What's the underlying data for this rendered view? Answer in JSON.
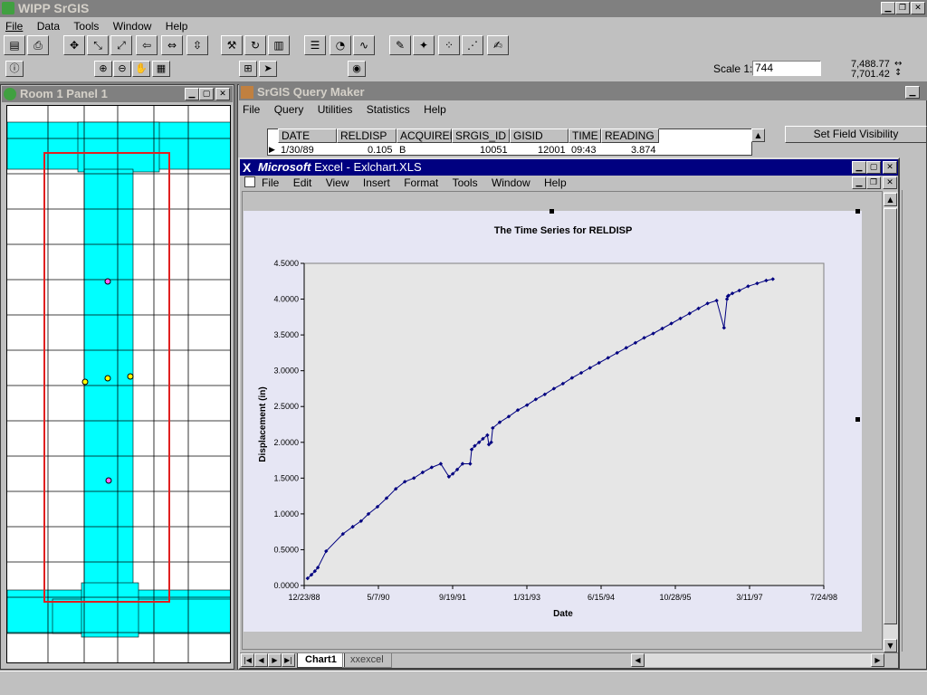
{
  "app": {
    "title": "WIPP SrGIS",
    "menu": [
      "File",
      "Data",
      "Tools",
      "Window",
      "Help"
    ]
  },
  "toolbar": {
    "scale_label": "Scale  1:",
    "scale_value": "744",
    "coord_x": "7,488.77",
    "coord_y": "7,701.42"
  },
  "map_panel": {
    "title": "Room 1 Panel 1"
  },
  "query_maker": {
    "title": "SrGIS Query Maker",
    "menu": [
      "File",
      "Query",
      "Utilities",
      "Statistics",
      "Help"
    ],
    "columns": [
      "DATE",
      "RELDISP",
      "ACQUIRED",
      "SRGIS_ID",
      "GISID",
      "TIME",
      "READING"
    ],
    "row": [
      "1/30/89",
      "0.105",
      "B",
      "10051",
      "12001",
      "09:43",
      "3.874"
    ],
    "set_field_button": "Set Field Visibility"
  },
  "excel": {
    "title_brand": "Microsoft",
    "title_rest": "Excel - Exlchart.XLS",
    "menu": [
      "File",
      "Edit",
      "View",
      "Insert",
      "Format",
      "Tools",
      "Window",
      "Help"
    ],
    "tabs": [
      "Chart1",
      "xxexcel"
    ]
  },
  "chart_data": {
    "type": "line",
    "title": "The Time Series for RELDISP",
    "xlabel": "Date",
    "ylabel": "Displacement (in)",
    "x_tick_labels": [
      "12/23/88",
      "5/7/90",
      "9/19/91",
      "1/31/93",
      "6/15/94",
      "10/28/95",
      "3/11/97",
      "7/24/98"
    ],
    "y_tick_labels": [
      "0.0000",
      "0.5000",
      "1.0000",
      "1.5000",
      "2.0000",
      "2.5000",
      "3.0000",
      "3.5000",
      "4.0000",
      "4.5000"
    ],
    "ylim": [
      0,
      4.5
    ],
    "xlim": [
      "1988-12-23",
      "1998-07-24"
    ],
    "grid": false,
    "legend": "none",
    "marker": "diamond",
    "color": "#000080",
    "series": [
      {
        "x": [
          "1989-01-15",
          "1989-02-10",
          "1989-03-05",
          "1989-03-25",
          "1989-05-20",
          "1989-09-10",
          "1989-11-15",
          "1990-01-10",
          "1990-03-01",
          "1990-05-01",
          "1990-07-01",
          "1990-09-01",
          "1990-11-01",
          "1991-01-01",
          "1991-03-01",
          "1991-05-01",
          "1991-07-01",
          "1991-08-25",
          "1991-09-20",
          "1991-10-20",
          "1991-11-25",
          "1992-01-15",
          "1992-01-25",
          "1992-02-15",
          "1992-03-15",
          "1992-04-10",
          "1992-05-10",
          "1992-05-20",
          "1992-06-05",
          "1992-06-15",
          "1992-08-01",
          "1992-10-01",
          "1992-12-01",
          "1993-02-01",
          "1993-04-01",
          "1993-06-01",
          "1993-08-01",
          "1993-10-01",
          "1993-12-01",
          "1994-02-01",
          "1994-04-01",
          "1994-06-01",
          "1994-08-01",
          "1994-10-01",
          "1994-12-01",
          "1995-02-01",
          "1995-04-01",
          "1995-06-01",
          "1995-08-01",
          "1995-10-01",
          "1995-12-01",
          "1996-02-01",
          "1996-04-01",
          "1996-06-01",
          "1996-08-01",
          "1996-09-20",
          "1996-10-10",
          "1996-10-15",
          "1996-10-20",
          "1996-11-15",
          "1997-01-01",
          "1997-03-01",
          "1997-05-01",
          "1997-07-01",
          "1997-08-15"
        ],
        "y": [
          0.1,
          0.15,
          0.2,
          0.25,
          0.48,
          0.72,
          0.82,
          0.9,
          1.0,
          1.1,
          1.22,
          1.35,
          1.45,
          1.5,
          1.58,
          1.65,
          1.7,
          1.52,
          1.56,
          1.62,
          1.7,
          1.7,
          1.9,
          1.95,
          2.0,
          2.05,
          2.1,
          1.97,
          2.0,
          2.2,
          2.28,
          2.36,
          2.45,
          2.52,
          2.6,
          2.67,
          2.75,
          2.82,
          2.9,
          2.97,
          3.04,
          3.11,
          3.18,
          3.25,
          3.32,
          3.39,
          3.46,
          3.52,
          3.59,
          3.66,
          3.73,
          3.8,
          3.87,
          3.94,
          3.98,
          3.6,
          4.0,
          4.04,
          4.05,
          4.08,
          4.12,
          4.18,
          4.22,
          4.26,
          4.28
        ]
      }
    ]
  }
}
